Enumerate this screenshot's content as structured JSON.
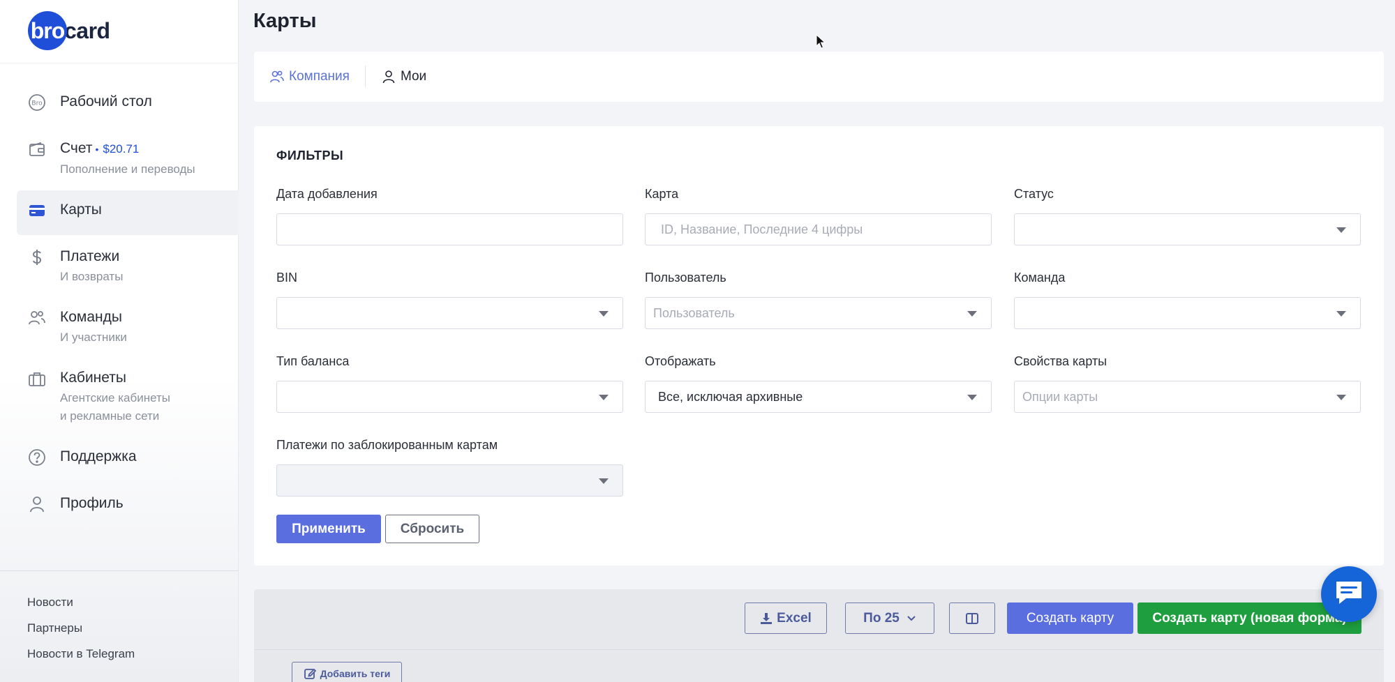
{
  "brand": {
    "logo_circle": "bro",
    "logo_rest": "card",
    "color": "#1f4fd8"
  },
  "sidebar": {
    "items": [
      {
        "title": "Рабочий стол",
        "icon": "bro-badge-icon"
      },
      {
        "title": "Счет",
        "amount": "$20.71",
        "sub": "Пополнение и переводы",
        "icon": "wallet-icon"
      },
      {
        "title": "Карты",
        "icon": "credit-card-icon",
        "active": true
      },
      {
        "title": "Платежи",
        "sub": "И возвраты",
        "icon": "dollar-icon"
      },
      {
        "title": "Команды",
        "sub": "И участники",
        "icon": "users-icon"
      },
      {
        "title": "Кабинеты",
        "sub1": "Агентские кабинеты",
        "sub2": "и рекламные сети",
        "icon": "briefcase-icon"
      },
      {
        "title": "Поддержка",
        "icon": "help-circle-icon"
      },
      {
        "title": "Профиль",
        "icon": "user-icon"
      }
    ],
    "footer": [
      "Новости",
      "Партнеры",
      "Новости в Telegram"
    ]
  },
  "page": {
    "title": "Карты"
  },
  "tabs": [
    {
      "label": "Компания",
      "active": true
    },
    {
      "label": "Мои",
      "active": false
    }
  ],
  "filters": {
    "title": "ФИЛЬТРЫ",
    "date_added": {
      "label": "Дата добавления",
      "value": ""
    },
    "card": {
      "label": "Карта",
      "placeholder": "ID, Название, Последние 4 цифры"
    },
    "status": {
      "label": "Статус",
      "value": ""
    },
    "bin": {
      "label": "BIN",
      "value": ""
    },
    "user": {
      "label": "Пользователь",
      "placeholder": "Пользователь"
    },
    "team": {
      "label": "Команда",
      "value": ""
    },
    "balance_type": {
      "label": "Тип баланса",
      "value": ""
    },
    "display": {
      "label": "Отображать",
      "value": "Все, исключая архивные"
    },
    "card_props": {
      "label": "Свойства карты",
      "placeholder": "Опции карты"
    },
    "blocked_payments": {
      "label": "Платежи по заблокированным картам",
      "value": ""
    },
    "apply_label": "Применить",
    "reset_label": "Сбросить"
  },
  "toolbar": {
    "excel_label": "Excel",
    "per_page_label": "По 25",
    "create_label": "Создать карту",
    "create_new_label": "Создать карту (новая форма)",
    "add_tags_label": "Добавить теги"
  },
  "colors": {
    "primary": "#5a6ee0",
    "green": "#1e9e3e",
    "chat": "#1565d8",
    "active_tab": "#5b72d8"
  }
}
